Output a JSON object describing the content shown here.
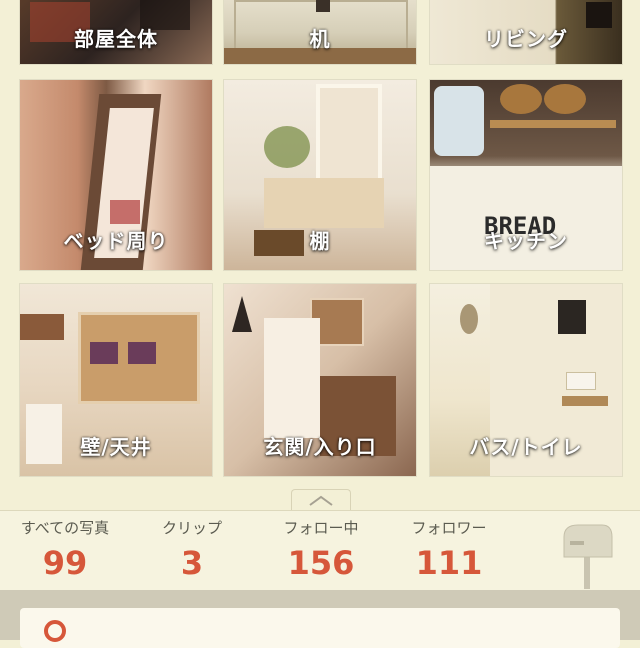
{
  "categories": [
    {
      "label": "部屋全体"
    },
    {
      "label": "机"
    },
    {
      "label": "リビング"
    },
    {
      "label": "ベッド周り"
    },
    {
      "label": "棚"
    },
    {
      "label": "キッチン"
    },
    {
      "label": "壁/天井"
    },
    {
      "label": "玄関/入り口"
    },
    {
      "label": "バス/トイレ"
    }
  ],
  "kitchen_sign": "BREAD",
  "stats": [
    {
      "name": "すべての写真",
      "value": "99"
    },
    {
      "name": "クリップ",
      "value": "3"
    },
    {
      "name": "フォロー中",
      "value": "156"
    },
    {
      "name": "フォロワー",
      "value": "111"
    }
  ],
  "icons": {
    "collapse": "chevron-up-icon",
    "mailbox": "mailbox-icon"
  },
  "colors": {
    "accent": "#d6573a",
    "background": "#f3f0d6"
  }
}
